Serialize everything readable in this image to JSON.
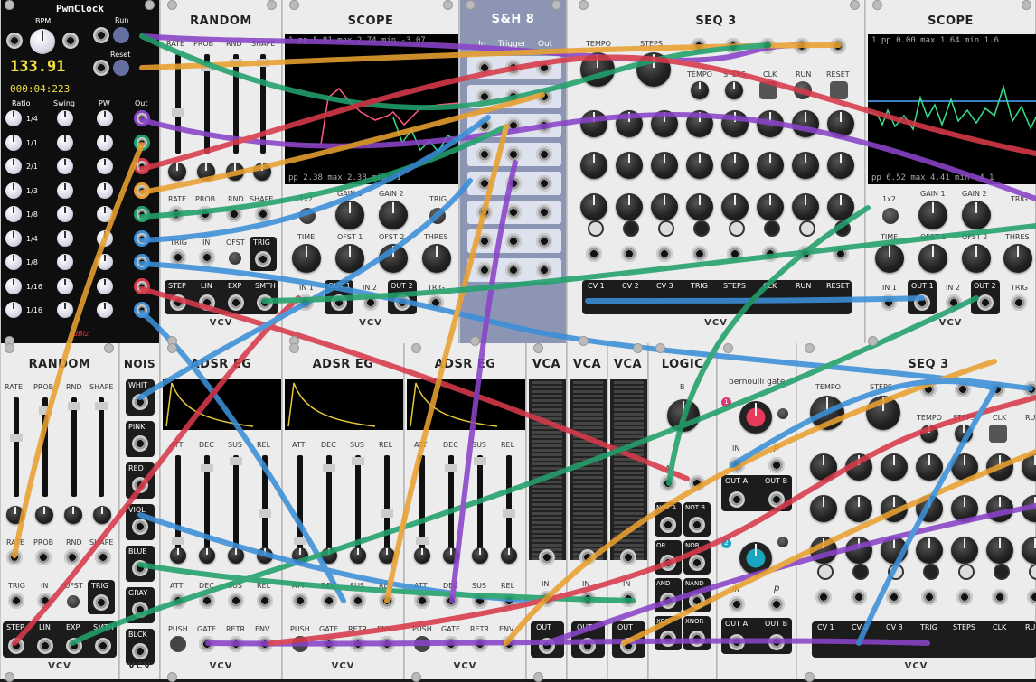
{
  "modules": {
    "pwmclock": {
      "title": "PwmClock",
      "bpm_label": "BPM",
      "bpm_value": "133.91",
      "time_value": "000:04:223",
      "run_label": "Run",
      "reset_label": "Reset",
      "col_headers": [
        "Ratio",
        "Swing",
        "PW",
        "Out"
      ],
      "ratios": [
        "1/4",
        "1/1",
        "2/1",
        "1/3",
        "1/8",
        "1/4",
        "1/8",
        "1/16",
        "1/16"
      ],
      "brand": "dBiz"
    },
    "random_top": {
      "title": "RANDOM",
      "labels": [
        "RATE",
        "PROB",
        "RND",
        "SHAPE"
      ],
      "bottom_labels": [
        "RATE",
        "PROB",
        "RND",
        "SHAPE"
      ],
      "trig_labels": [
        "TRIG",
        "IN",
        "OFST",
        "TRIG"
      ],
      "out_labels": [
        "STEP",
        "LIN",
        "EXP",
        "SMTH"
      ],
      "brand": "VCV"
    },
    "scope_top": {
      "title": "SCOPE",
      "top_readout": "1  pp   5.81 max   2.74 min  -3.07",
      "bottom_readout": "pp   2.38 max   2.38 min  -1",
      "labels": [
        "1x2",
        "GAIN 1",
        "GAIN 2",
        "TRIG",
        "TIME",
        "OFST 1",
        "OFST 2",
        "THRES",
        "IN 1",
        "OUT 1",
        "IN 2",
        "OUT 2",
        "TRIG"
      ],
      "brand": "VCV"
    },
    "sh8": {
      "title": "S&H 8",
      "col_labels": [
        "In",
        "Trigger",
        "Out"
      ]
    },
    "seq3_top": {
      "title": "SEQ 3",
      "labels": [
        "TEMPO",
        "STEPS",
        "TEMPO",
        "STEPS",
        "CLK",
        "RUN",
        "RESET"
      ],
      "out_labels": [
        "CV 1",
        "CV 2",
        "CV 3",
        "TRIG",
        "STEPS",
        "CLK",
        "RUN",
        "RESET"
      ],
      "brand": "VCV"
    },
    "scope_right": {
      "title": "SCOPE",
      "top_readout": "1  pp   0.00 max   1.64 min   1.6",
      "bottom_readout": "pp   6.52 max   4.41 min  -4.1",
      "labels": [
        "1x2",
        "GAIN 1",
        "GAIN 2",
        "TRIG",
        "TIME",
        "OFST 1",
        "OFST 2",
        "THRES",
        "IN 1",
        "OUT 1",
        "IN 2",
        "OUT 2",
        "TRIG"
      ],
      "brand": "VCV"
    },
    "random_bottom": {
      "title": "RANDOM",
      "labels": [
        "RATE",
        "PROB",
        "RND",
        "SHAPE"
      ],
      "knob_labels": [
        "RATE",
        "PROB",
        "RND",
        "SHAPE"
      ],
      "trig_labels": [
        "TRIG",
        "IN",
        "OFST",
        "TRIG"
      ],
      "out_labels": [
        "STEP",
        "LIN",
        "EXP",
        "SMTH"
      ],
      "brand": "VCV"
    },
    "noise": {
      "title": "NOIS",
      "outputs": [
        "WHIT",
        "PINK",
        "RED",
        "VIOL",
        "BLUE",
        "GRAY",
        "BLCK"
      ],
      "brand": "VCV"
    },
    "adsr": {
      "title": "ADSR EG",
      "labels": [
        "ATT",
        "DEC",
        "SUS",
        "REL"
      ],
      "jack_labels": [
        "ATT",
        "DEC",
        "SUS",
        "REL"
      ],
      "bottom_labels": [
        "PUSH",
        "GATE",
        "RETR",
        "ENV"
      ],
      "brand": "VCV"
    },
    "vca": {
      "title": "VCA",
      "in_label": "IN",
      "out_label": "OUT"
    },
    "logic": {
      "title": "LOGIC",
      "b_label": "B",
      "a_label": "A",
      "gates": [
        "NOT A",
        "NOT B",
        "OR",
        "NOR",
        "AND",
        "NAND",
        "XOR",
        "XNOR"
      ]
    },
    "bernoulli": {
      "title": "bernoulli gate",
      "in_label": "IN",
      "p_label": "p",
      "outa": "OUT A",
      "outb": "OUT B",
      "badge1": "1",
      "badge2": "2"
    },
    "seq3_bottom": {
      "title": "SEQ 3",
      "labels": [
        "TEMPO",
        "STEPS",
        "TEMPO",
        "STEPS",
        "CLK",
        "RU"
      ],
      "out_labels": [
        "CV 1",
        "CV 2",
        "CV 3",
        "TRIG",
        "STEPS",
        "CLK",
        "RU"
      ],
      "brand": "VCV"
    }
  },
  "colors": {
    "rack_panel": "#ececec",
    "cable_red": "#d83a4a",
    "cable_green": "#22a06b",
    "cable_blue": "#3b8fd8",
    "cable_purple": "#8a44c8",
    "cable_orange": "#e8a030",
    "pwm_display": "#f0e040"
  }
}
